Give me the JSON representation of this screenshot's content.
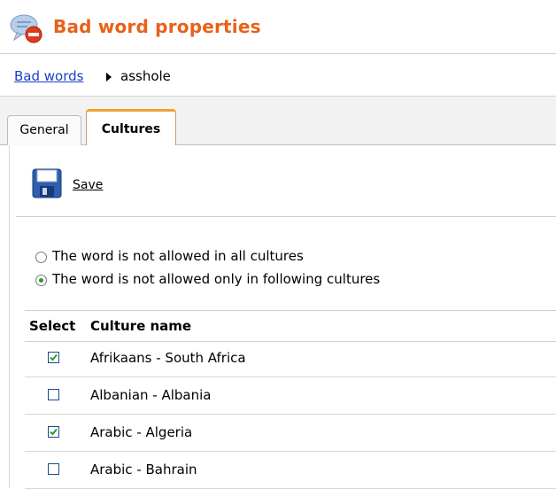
{
  "header": {
    "title": "Bad word properties",
    "icon": "bad-word-icon"
  },
  "breadcrumb": {
    "parent": "Bad words",
    "current": "asshole"
  },
  "tabs": [
    {
      "label": "General",
      "selected": false
    },
    {
      "label": "Cultures",
      "selected": true
    }
  ],
  "toolbar": {
    "save_label": "Save",
    "save_icon": "floppy-disk-icon"
  },
  "options": {
    "all_cultures": {
      "label": "The word is not allowed in all cultures",
      "selected": false
    },
    "following_cultures": {
      "label": "The word is not allowed only in following cultures",
      "selected": true
    }
  },
  "grid": {
    "columns": [
      "Select",
      "Culture name"
    ],
    "rows": [
      {
        "name": "Afrikaans - South Africa",
        "checked": true
      },
      {
        "name": "Albanian - Albania",
        "checked": false
      },
      {
        "name": "Arabic - Algeria",
        "checked": true
      },
      {
        "name": "Arabic - Bahrain",
        "checked": false
      }
    ]
  },
  "colors": {
    "title": "#e8611a",
    "link": "#1a3fc4",
    "active_tab": "#f0a030",
    "check": "#2a9a2a"
  }
}
